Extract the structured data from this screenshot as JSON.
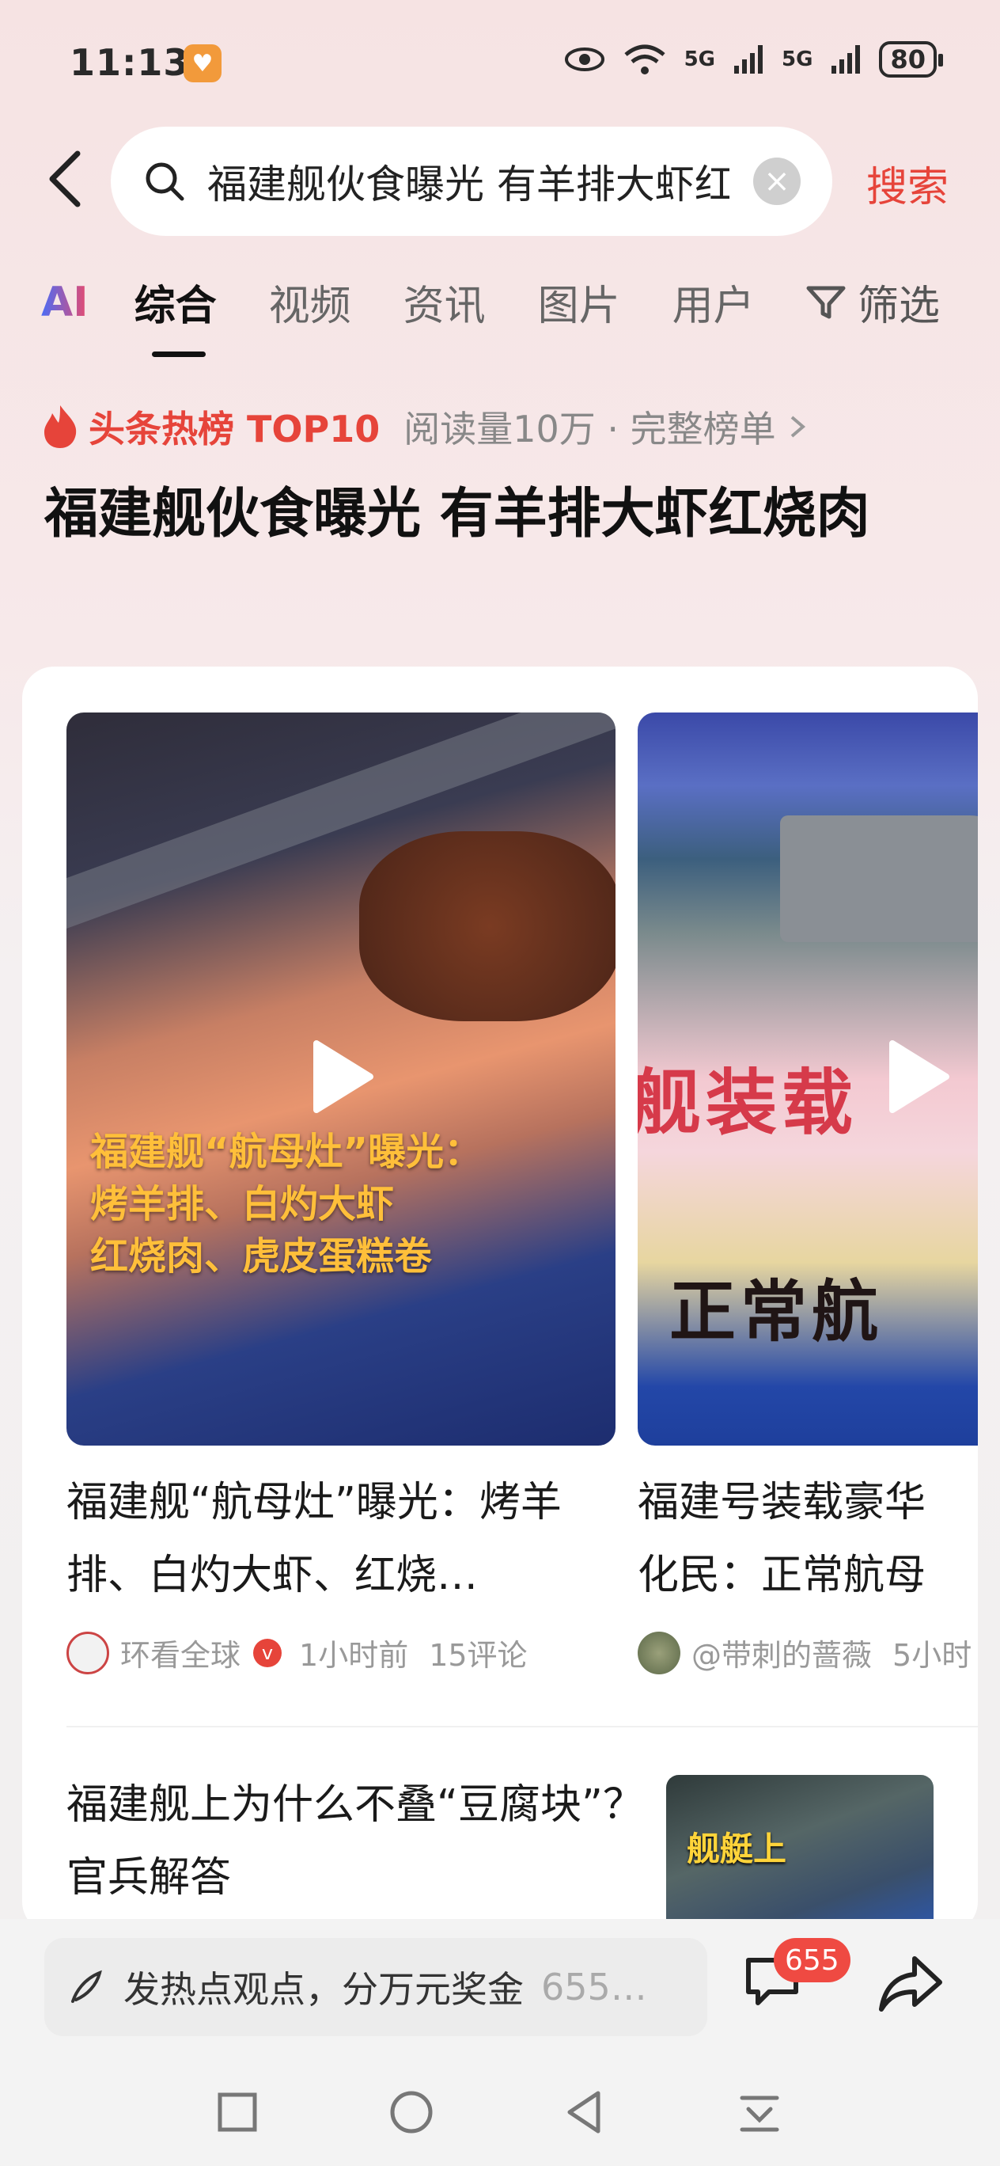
{
  "status_bar": {
    "time": "11:13",
    "battery": "80",
    "signal1": "5G",
    "signal2": "5G"
  },
  "search": {
    "query": "福建舰伙食曝光 有羊排大虾红烧肉",
    "button": "搜索"
  },
  "tabs": [
    {
      "label": "AI"
    },
    {
      "label": "综合"
    },
    {
      "label": "视频"
    },
    {
      "label": "资讯"
    },
    {
      "label": "图片"
    },
    {
      "label": "用户"
    }
  ],
  "filter_label": "筛选",
  "hot": {
    "label": "头条热榜 TOP10",
    "meta": "阅读量10万 · 完整榜单"
  },
  "page_title": "福建舰伙食曝光 有羊排大虾红烧肉",
  "videos": [
    {
      "overlay": [
        "福建舰“航母灶”曝光：",
        "烤羊排、白灼大虾",
        "红烧肉、虎皮蛋糕卷"
      ],
      "title": "福建舰“航母灶”曝光：烤羊排、白灼大虾、红烧…",
      "author": "环看全球",
      "verified": "v",
      "time": "1小时前",
      "comments": "15评论"
    },
    {
      "overlay_top": "舰装载",
      "overlay_bottom": "正常航",
      "title_line1": "福建号装载豪华",
      "title_line2": "化民：正常航母",
      "author": "@带刺的蔷薇",
      "time": "5小时"
    }
  ],
  "article": {
    "title": "福建舰上为什么不叠“豆腐块”？官兵解答",
    "thumb_text": "舰艇上"
  },
  "bottom": {
    "comment_hint": "发热点观点，分万元奖金",
    "comment_count_preview": "655…",
    "badge": "655"
  },
  "colors": {
    "accent": "#e6443a",
    "badge": "#ef4a42",
    "overlay_yellow": "#ffbf3a"
  }
}
